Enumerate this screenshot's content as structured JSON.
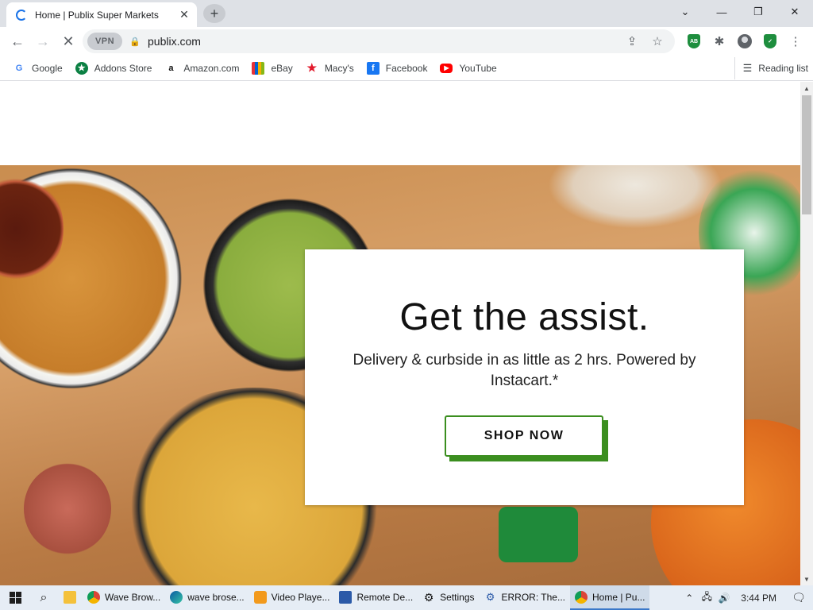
{
  "browser": {
    "tab_title": "Home | Publix Super Markets",
    "url": "publix.com",
    "vpn_label": "VPN",
    "reading_list": "Reading list"
  },
  "bookmarks": [
    {
      "label": "Google",
      "icon": "google-icon",
      "color": "#4285f4"
    },
    {
      "label": "Addons Store",
      "icon": "addons-store-icon",
      "color": "#0b8043"
    },
    {
      "label": "Amazon.com",
      "icon": "amazon-icon",
      "color": "#111111"
    },
    {
      "label": "eBay",
      "icon": "ebay-icon",
      "color": "#e53238"
    },
    {
      "label": "Macy's",
      "icon": "macys-star-icon",
      "color": "#e21a2c"
    },
    {
      "label": "Facebook",
      "icon": "facebook-icon",
      "color": "#1877f2"
    },
    {
      "label": "YouTube",
      "icon": "youtube-icon",
      "color": "#ff0000"
    }
  ],
  "hero": {
    "headline": "Get the assist.",
    "subtext": "Delivery & curbside in as little as 2 hrs. Powered by Instacart.*",
    "cta_label": "SHOP NOW",
    "cta_color": "#3b8e1f"
  },
  "taskbar": {
    "apps": [
      {
        "label": "Wave Brow...",
        "icon": "chrome-icon"
      },
      {
        "label": "wave brose...",
        "icon": "edge-icon"
      },
      {
        "label": "Video Playe...",
        "icon": "video-player-icon"
      },
      {
        "label": "Remote De...",
        "icon": "remote-desktop-icon"
      },
      {
        "label": "Settings",
        "icon": "settings-icon"
      },
      {
        "label": "ERROR: The...",
        "icon": "error-app-icon"
      },
      {
        "label": "Home | Pu...",
        "icon": "chrome-icon"
      }
    ],
    "time": "3:44 PM"
  }
}
